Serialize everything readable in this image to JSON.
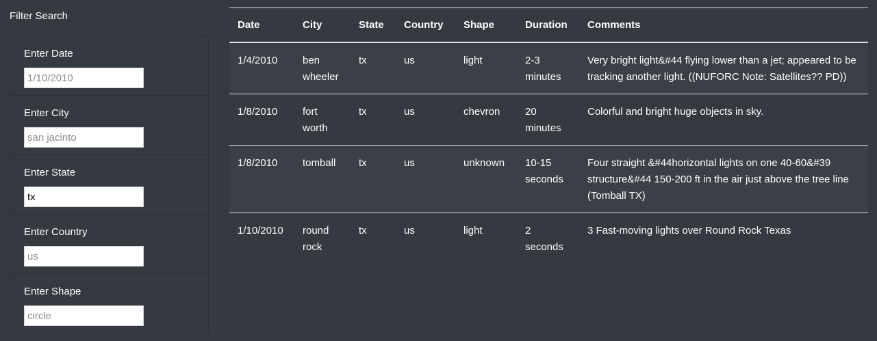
{
  "sidebar": {
    "title": "Filter Search",
    "filters": [
      {
        "label": "Enter Date",
        "value": "",
        "placeholder": "1/10/2010"
      },
      {
        "label": "Enter City",
        "value": "",
        "placeholder": "san jacinto"
      },
      {
        "label": "Enter State",
        "value": "tx",
        "placeholder": ""
      },
      {
        "label": "Enter Country",
        "value": "",
        "placeholder": "us"
      },
      {
        "label": "Enter Shape",
        "value": "",
        "placeholder": "circle"
      }
    ]
  },
  "table": {
    "headers": [
      "Date",
      "City",
      "State",
      "Country",
      "Shape",
      "Duration",
      "Comments"
    ],
    "rows": [
      [
        "1/4/2010",
        "ben wheeler",
        "tx",
        "us",
        "light",
        "2-3 minutes",
        "Very bright light&#44 flying lower than a jet; appeared to be tracking another light. ((NUFORC Note: Satellites?? PD))"
      ],
      [
        "1/8/2010",
        "fort worth",
        "tx",
        "us",
        "chevron",
        "20 minutes",
        "Colorful and bright huge objects in sky."
      ],
      [
        "1/8/2010",
        "tomball",
        "tx",
        "us",
        "unknown",
        "10-15 seconds",
        "Four straight &#44horizontal lights on one 40-60&#39 structure&#44 150-200 ft in the air just above the tree line (Tomball TX)"
      ],
      [
        "1/10/2010",
        "round rock",
        "tx",
        "us",
        "light",
        "2 seconds",
        "3 Fast-moving lights over Round Rock Texas"
      ]
    ]
  }
}
